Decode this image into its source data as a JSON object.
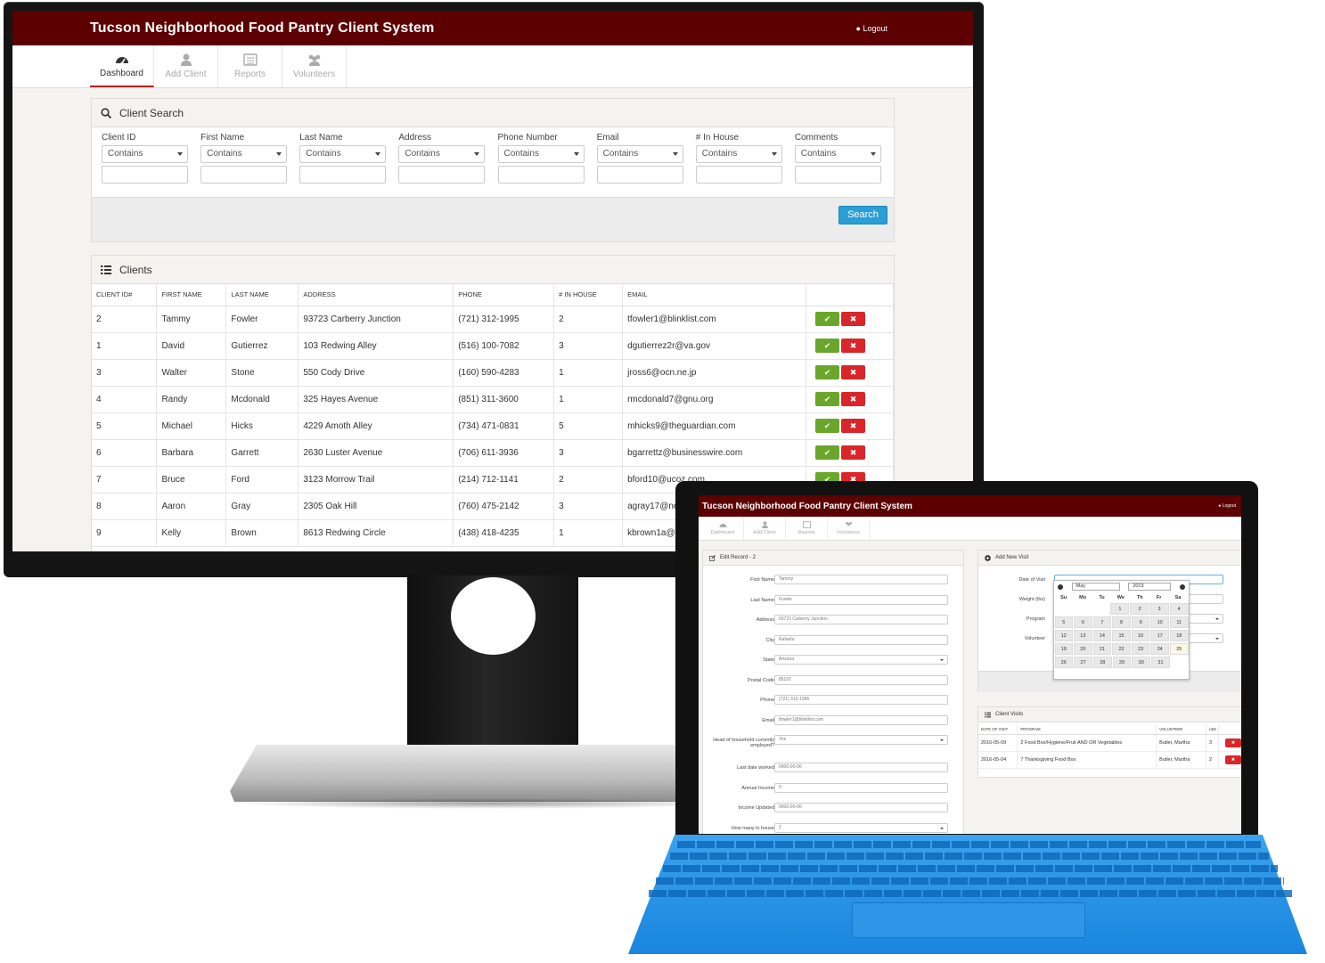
{
  "app": {
    "title": "Tucson Neighborhood Food Pantry Client System",
    "logout_label": "Logout",
    "accent": "#5c0002"
  },
  "nav": {
    "tabs": [
      {
        "label": "Dashboard",
        "icon": "dashboard-icon"
      },
      {
        "label": "Add Client",
        "icon": "user-icon"
      },
      {
        "label": "Reports",
        "icon": "list-alt-icon"
      },
      {
        "label": "Volunteers",
        "icon": "users-icon"
      }
    ]
  },
  "search": {
    "title": "Client Search",
    "fields": [
      {
        "label": "Client ID",
        "operator": "Contains"
      },
      {
        "label": "First Name",
        "operator": "Contains"
      },
      {
        "label": "Last Name",
        "operator": "Contains"
      },
      {
        "label": "Address",
        "operator": "Contains"
      },
      {
        "label": "Phone Number",
        "operator": "Contains"
      },
      {
        "label": "Email",
        "operator": "Contains"
      },
      {
        "label": "# In House",
        "operator": "Contains"
      },
      {
        "label": "Comments",
        "operator": "Contains"
      }
    ],
    "button_label": "Search"
  },
  "clients": {
    "title": "Clients",
    "columns": [
      "CLIENT ID#",
      "FIRST NAME",
      "LAST NAME",
      "ADDRESS",
      "PHONE",
      "# IN HOUSE",
      "EMAIL"
    ],
    "rows": [
      [
        "2",
        "Tammy",
        "Fowler",
        "93723 Carberry Junction",
        "(721) 312-1995",
        "2",
        "tfowler1@blinklist.com"
      ],
      [
        "1",
        "David",
        "Gutierrez",
        "103 Redwing Alley",
        "(516) 100-7082",
        "3",
        "dgutierrez2r@va.gov"
      ],
      [
        "3",
        "Walter",
        "Stone",
        "550 Cody Drive",
        "(160) 590-4283",
        "1",
        "jross6@ocn.ne.jp"
      ],
      [
        "4",
        "Randy",
        "Mcdonald",
        "325 Hayes Avenue",
        "(851) 311-3600",
        "1",
        "rmcdonald7@gnu.org"
      ],
      [
        "5",
        "Michael",
        "Hicks",
        "4229 Amoth Alley",
        "(734) 471-0831",
        "5",
        "mhicks9@theguardian.com"
      ],
      [
        "6",
        "Barbara",
        "Garrett",
        "2630 Luster Avenue",
        "(706) 611-3936",
        "3",
        "bgarrettz@businesswire.com"
      ],
      [
        "7",
        "Bruce",
        "Ford",
        "3123 Morrow Trail",
        "(214) 712-1141",
        "2",
        "bford10@ucoz.com"
      ],
      [
        "8",
        "Aaron",
        "Gray",
        "2305 Oak Hill",
        "(760) 475-2142",
        "3",
        "agray17@ne"
      ],
      [
        "9",
        "Kelly",
        "Brown",
        "8613 Redwing Circle",
        "(438) 418-4235",
        "1",
        "kbrown1a@b"
      ]
    ]
  },
  "edit_record": {
    "title": "Edit Record - 2",
    "fields": [
      {
        "label": "First Name",
        "value": "Tammy"
      },
      {
        "label": "Last Name",
        "value": "Fowler"
      },
      {
        "label": "Address",
        "value": "93723 Carberry Junction"
      },
      {
        "label": "City",
        "value": "Rafaela"
      },
      {
        "label": "State",
        "value": "Arizona"
      },
      {
        "label": "Postal Code",
        "value": "85152"
      },
      {
        "label": "Phone",
        "value": "(721) 312-1995"
      },
      {
        "label": "Email",
        "value": "tfowler1@blinklist.com"
      },
      {
        "label": "Head of household currently employed?",
        "value": "Yes"
      },
      {
        "label": "Last date worked",
        "value": "0000-00-00"
      },
      {
        "label": "Annual Income",
        "value": "0"
      },
      {
        "label": "Income Updated",
        "value": "0000-00-00"
      },
      {
        "label": "How many in house",
        "value": "2"
      }
    ]
  },
  "add_visit": {
    "title": "Add New Visit",
    "fields": [
      "Date of Visit",
      "Weight (lbs)",
      "Program",
      "Volunteer"
    ],
    "calendar": {
      "month": "May",
      "year": "2019",
      "dow": [
        "Su",
        "Mo",
        "Tu",
        "We",
        "Th",
        "Fr",
        "Sa"
      ],
      "weeks": [
        [
          "",
          "",
          "",
          "1",
          "2",
          "3",
          "4"
        ],
        [
          "5",
          "6",
          "7",
          "8",
          "9",
          "10",
          "11"
        ],
        [
          "12",
          "13",
          "14",
          "15",
          "16",
          "17",
          "18"
        ],
        [
          "19",
          "20",
          "21",
          "22",
          "23",
          "24",
          "25"
        ],
        [
          "26",
          "27",
          "28",
          "29",
          "30",
          "31",
          ""
        ]
      ]
    }
  },
  "visits": {
    "title": "Client Visits",
    "columns": [
      "DATE OF VISIT",
      "PROGRAM",
      "VOLUNTEER",
      "LBS"
    ],
    "rows": [
      [
        "2016-05-09",
        "2 Food Box/Hygiene/Fruit AND OR Vegetables",
        "Butler, Martha",
        "3"
      ],
      [
        "2016-05-04",
        "7 Thanksgiving Food Box",
        "Butler, Martha",
        "2"
      ]
    ]
  },
  "colors": {
    "confirm": "#6aa62c",
    "delete": "#d9262a",
    "search_button": "#2a9fd6",
    "keyboard": "#1985dd"
  }
}
